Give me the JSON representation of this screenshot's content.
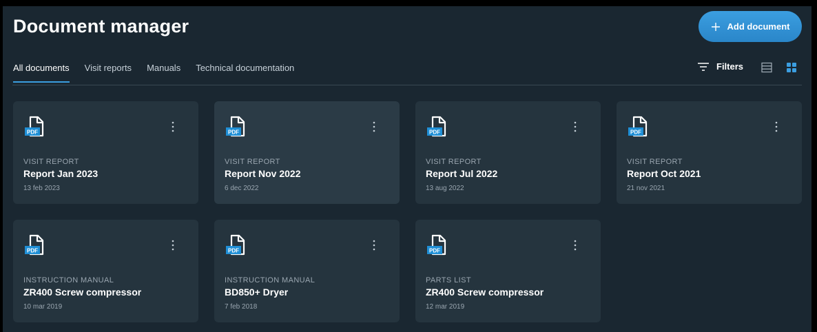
{
  "header": {
    "title": "Document manager",
    "add_button_label": "Add document"
  },
  "tabs": [
    {
      "label": "All documents",
      "active": true
    },
    {
      "label": "Visit reports",
      "active": false
    },
    {
      "label": "Manuals",
      "active": false
    },
    {
      "label": "Technical documentation",
      "active": false
    }
  ],
  "toolbar": {
    "filters_label": "Filters",
    "active_view": "grid"
  },
  "icons": {
    "file_badge_text": "PDF"
  },
  "colors": {
    "accent": "#3b9ee0",
    "background": "#1a2731",
    "card": "#25343e"
  },
  "documents": [
    {
      "category": "VISIT REPORT",
      "name": "Report Jan 2023",
      "date": "13 feb 2023"
    },
    {
      "category": "VISIT REPORT",
      "name": "Report Nov 2022",
      "date": "6 dec 2022"
    },
    {
      "category": "VISIT REPORT",
      "name": "Report Jul 2022",
      "date": "13 aug 2022"
    },
    {
      "category": "VISIT REPORT",
      "name": "Report Oct 2021",
      "date": "21 nov 2021"
    },
    {
      "category": "INSTRUCTION MANUAL",
      "name": "ZR400 Screw compressor",
      "date": "10 mar 2019"
    },
    {
      "category": "INSTRUCTION MANUAL",
      "name": "BD850+ Dryer",
      "date": "7 feb 2018"
    },
    {
      "category": "PARTS LIST",
      "name": "ZR400 Screw compressor",
      "date": "12 mar 2019"
    }
  ]
}
